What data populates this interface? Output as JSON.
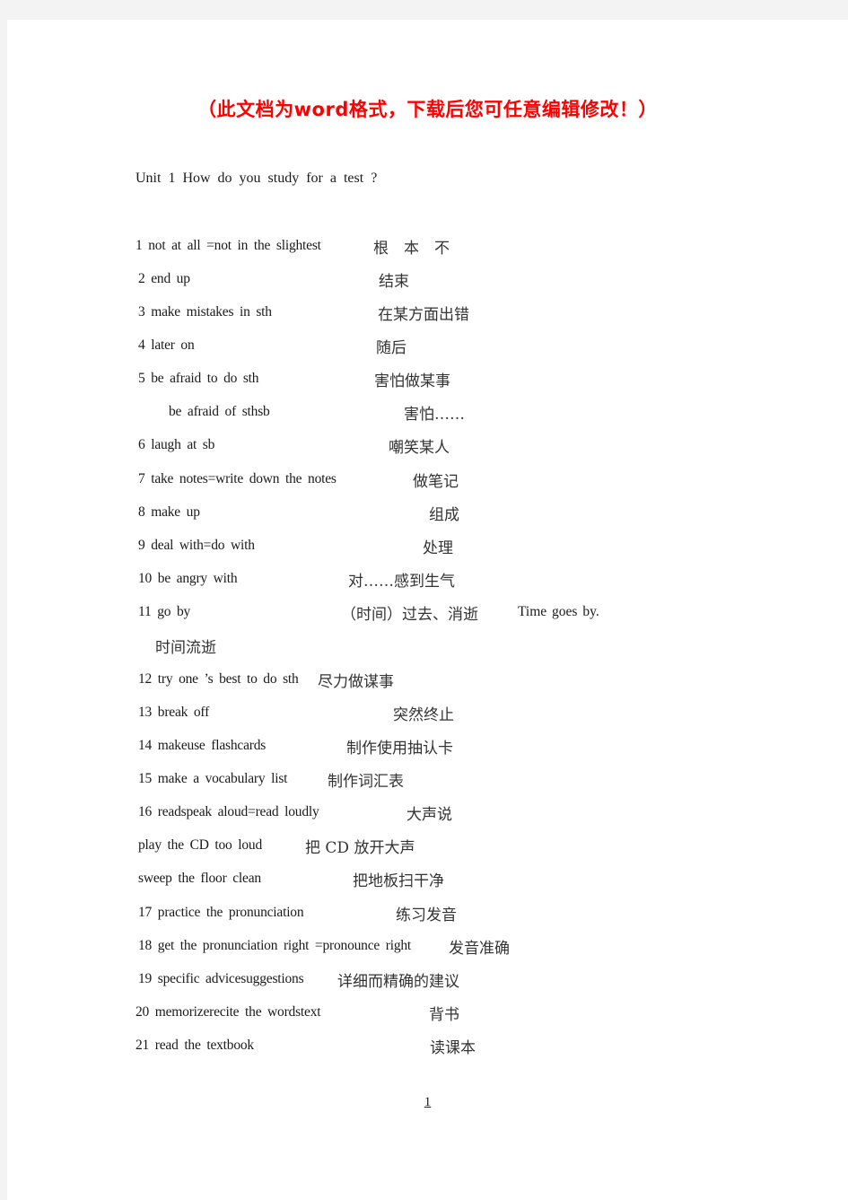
{
  "banner": "（此文档为word格式，下载后您可任意编辑修改！）",
  "unit_title": "Unit 1 How do you study for a test ?",
  "entries": [
    {
      "en": "1 not at all =not in the slightest",
      "zh": "根　本　不"
    },
    {
      "en": "2 end up",
      "zh": "结束"
    },
    {
      "en": "3 make mistakes in sth",
      "zh": "在某方面出错"
    },
    {
      "en": "4 later on",
      "zh": "随后"
    },
    {
      "en": "5 be afraid to do sth",
      "zh": "害怕做某事"
    },
    {
      "en": "be afraid of sthsb",
      "zh": "害怕……"
    },
    {
      "en": "6 laugh at sb",
      "zh": "嘲笑某人"
    },
    {
      "en": "7 take notes=write down the notes",
      "zh": "做笔记"
    },
    {
      "en": "8 make up",
      "zh": "组成"
    },
    {
      "en": "9 deal with=do with",
      "zh": "处理"
    },
    {
      "en": "10 be angry with",
      "zh": "对……感到生气"
    },
    {
      "en": "11 go by",
      "zh": "（时间）过去、消逝",
      "extra": "Time goes by.",
      "continuation": "时间流逝"
    },
    {
      "en": "12 try one ’s best to do sth",
      "zh": "尽力做谋事"
    },
    {
      "en": "13 break off",
      "zh": "突然终止"
    },
    {
      "en": "14 makeuse flashcards",
      "zh": "制作使用抽认卡"
    },
    {
      "en": "15 make a vocabulary list",
      "zh": "制作词汇表"
    },
    {
      "en": "16 readspeak aloud=read loudly",
      "zh": "大声说"
    },
    {
      "en": "play the CD too loud",
      "zh": "把 CD 放开大声"
    },
    {
      "en": "sweep the floor clean",
      "zh": "把地板扫干净"
    },
    {
      "en": "17 practice the pronunciation",
      "zh": "练习发音"
    },
    {
      "en": "18 get the pronunciation right =pronounce right",
      "zh": "发音准确"
    },
    {
      "en": "19 specific advicesuggestions",
      "zh": "详细而精确的建议"
    },
    {
      "en": "20 memorizerecite the wordstext",
      "zh": "背书"
    },
    {
      "en": "21 read the textbook",
      "zh": "读课本"
    }
  ],
  "page_number": "1"
}
